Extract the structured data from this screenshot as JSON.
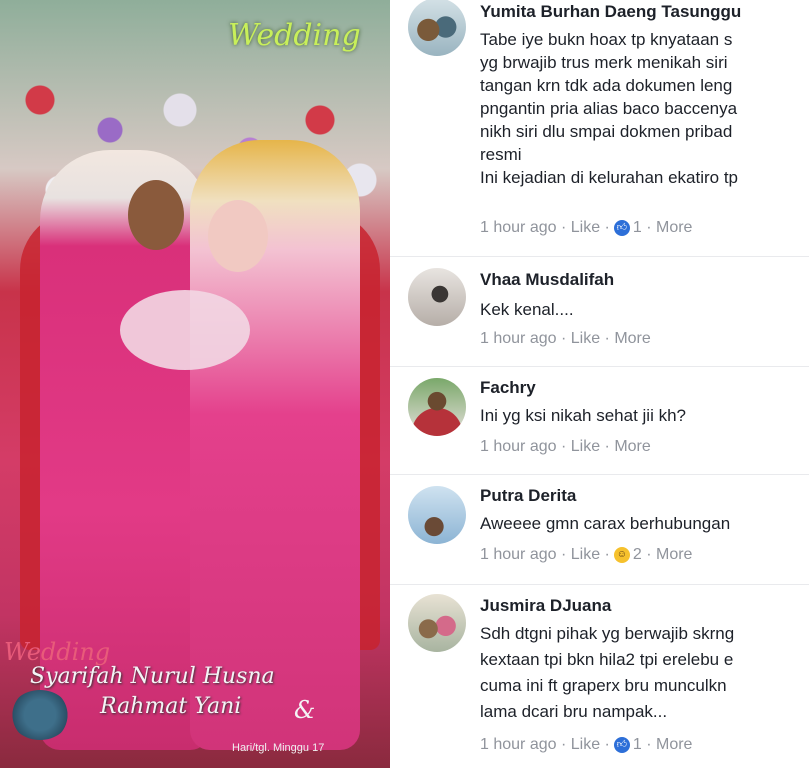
{
  "photo": {
    "title": "Wedding",
    "sub_title": "Wedding",
    "names_line1": "Syarifah Nurul Husna",
    "names_line2": "Rahmat Yani",
    "ampersand": "&",
    "date_text": "Hari/tgl.  Minggu  17"
  },
  "comments": [
    {
      "name": "Yumita Burhan Daeng Tasunggu",
      "lines": [
        "Tabe iye bukn hoax tp knyataan s",
        "yg brwajib trus merk menikah siri",
        "tangan krn tdk ada dokumen leng",
        "pngantin pria alias baco baccenya",
        "nikh siri dlu smpai dokmen pribad",
        "resmi",
        "Ini kejadian di kelurahan ekatiro tp"
      ],
      "time": "1 hour ago",
      "like": "Like",
      "reaction": "like",
      "reaction_count": "1",
      "more": "More"
    },
    {
      "name": "Vhaa Musdalifah",
      "lines": [
        "Kek kenal...."
      ],
      "time": "1 hour ago",
      "like": "Like",
      "reaction": "",
      "reaction_count": "",
      "more": "More"
    },
    {
      "name": "Fachry",
      "lines": [
        "Ini yg ksi nikah sehat jii kh?"
      ],
      "time": "1 hour ago",
      "like": "Like",
      "reaction": "",
      "reaction_count": "",
      "more": "More"
    },
    {
      "name": "Putra Derita",
      "lines": [
        "Aweeee gmn carax berhubungan"
      ],
      "time": "1 hour ago",
      "like": "Like",
      "reaction": "haha",
      "reaction_count": "2",
      "more": "More"
    },
    {
      "name": "Jusmira DJuana",
      "lines": [
        "Sdh dtgni pihak yg berwajib skrng",
        "kextaan tpi bkn hila2 tpi erelebu e",
        "cuma ini ft graperx bru munculkn",
        "lama dcari bru nampak..."
      ],
      "time": "1 hour ago",
      "like": "Like",
      "reaction": "like",
      "reaction_count": "1",
      "more": "More"
    }
  ]
}
